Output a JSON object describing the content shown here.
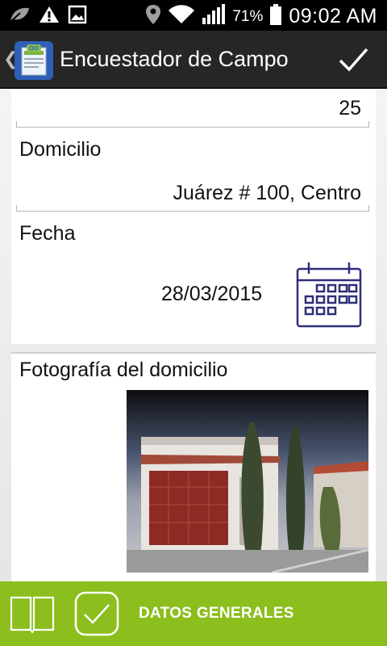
{
  "status_bar": {
    "battery_pct": "71%",
    "time": "09:02 AM",
    "icons": [
      "leaf-icon",
      "warning-icon",
      "image-icon",
      "location-icon",
      "wifi-icon",
      "signal-icon",
      "battery-icon"
    ]
  },
  "action_bar": {
    "title": "Encuestador de Campo",
    "confirm_icon": "check-icon"
  },
  "form": {
    "number_value": "25",
    "address_label": "Domicilio",
    "address_value": "Juárez # 100, Centro",
    "date_label": "Fecha",
    "date_value": "28/03/2015",
    "photo_label": "Fotografía del domicilio"
  },
  "bottom_bar": {
    "section_label": "DATOS GENERALES"
  },
  "colors": {
    "action_bar_bg": "#262626",
    "bottom_bar_bg": "#8cbe1e",
    "calendar_icon": "#2e2e7a"
  }
}
